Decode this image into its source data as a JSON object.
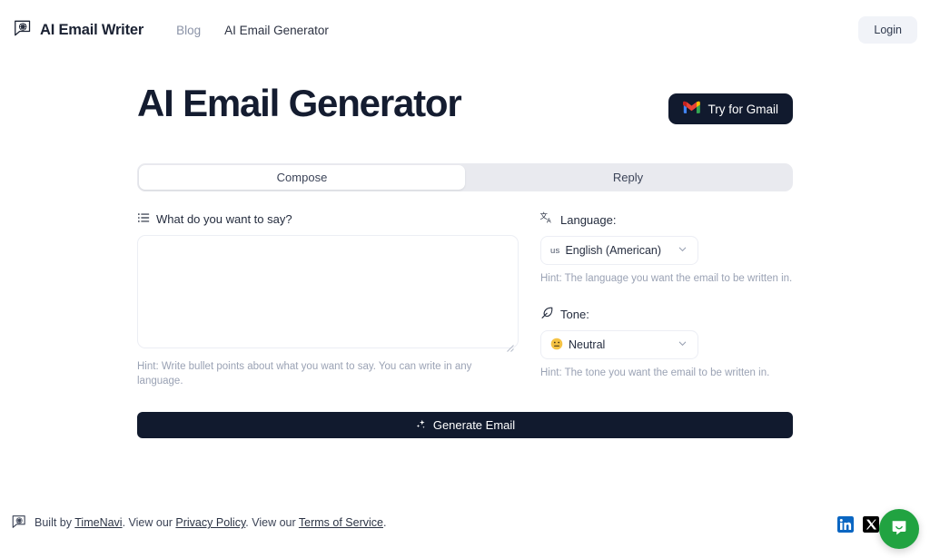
{
  "header": {
    "brand_name": "AI Email Writer",
    "brand_icon": "speech-bubble-swirl-logo",
    "nav": [
      {
        "label": "Blog",
        "active": false
      },
      {
        "label": "AI Email Generator",
        "active": true
      }
    ],
    "login_label": "Login"
  },
  "main": {
    "title": "AI Email Generator",
    "gmail_button": {
      "label": "Try for Gmail",
      "icon": "gmail-icon",
      "bg": "#111a2e"
    },
    "tabs": [
      {
        "label": "Compose",
        "active": true
      },
      {
        "label": "Reply",
        "active": false
      }
    ],
    "compose": {
      "label": "What do you want to say?",
      "icon": "bullet-list-icon",
      "value": "",
      "placeholder": "",
      "hint": "Hint: Write bullet points about what you want to say. You can write in any language."
    },
    "language": {
      "label": "Language:",
      "icon": "translate-icon",
      "flag": "us",
      "value": "English (American)",
      "hint": "Hint: The language you want the email to be written in."
    },
    "tone": {
      "label": "Tone:",
      "icon": "feather-quill-icon",
      "emoji": "😐",
      "value": "Neutral",
      "hint": "Hint: The tone you want the email to be written in."
    },
    "generate_button": {
      "label": "Generate Email",
      "icon": "sparkles-icon"
    }
  },
  "footer": {
    "icon": "speech-bubble-swirl-logo",
    "prefix": "Built by ",
    "brand_link": "TimeNavi",
    "mid1": ". View our ",
    "privacy_link": "Privacy Policy",
    "mid2": ". View our ",
    "terms_link": "Terms of Service",
    "suffix": ".",
    "socials": [
      {
        "name": "linkedin",
        "color": "#0a66c2"
      },
      {
        "name": "x-twitter",
        "color": "#000000"
      }
    ],
    "chat_launcher": {
      "icon": "chat-bubble-icon",
      "color": "#21a341"
    }
  },
  "colors": {
    "dark": "#111a2e",
    "title": "#141c30",
    "tab_bg": "#e9eaef",
    "hint": "#9aa2b4",
    "border": "#eceef4"
  }
}
